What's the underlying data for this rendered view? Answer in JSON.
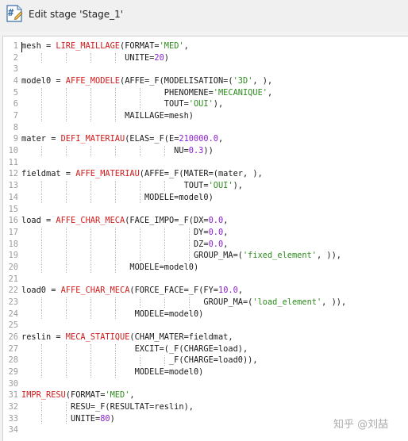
{
  "window": {
    "title": "Edit stage 'Stage_1'",
    "icon": "hash-document-icon"
  },
  "watermark": "知乎 @刘喆",
  "colors": {
    "command": "#d11a1a",
    "string": "#2e8b1e",
    "number": "#8a1fd1",
    "line_number": "#9a9a9a"
  },
  "lines": [
    {
      "n": "1",
      "t": [
        [
          "mesh = ",
          ""
        ],
        [
          "LIRE_MAILLAGE",
          "kw"
        ],
        [
          "(FORMAT=",
          ""
        ],
        [
          "'MED'",
          "str"
        ],
        [
          ",",
          ""
        ]
      ]
    },
    {
      "n": "2",
      "t": [
        [
          "                     UNITE=",
          ""
        ],
        [
          "20",
          "num"
        ],
        [
          ")",
          ""
        ]
      ]
    },
    {
      "n": "3",
      "t": []
    },
    {
      "n": "4",
      "t": [
        [
          "model0 = ",
          ""
        ],
        [
          "AFFE_MODELE",
          "kw"
        ],
        [
          "(AFFE=_F(MODELISATION=(",
          ""
        ],
        [
          "'3D'",
          "str"
        ],
        [
          ", ),",
          ""
        ]
      ]
    },
    {
      "n": "5",
      "t": [
        [
          "                             PHENOMENE=",
          ""
        ],
        [
          "'MECANIQUE'",
          "str"
        ],
        [
          ",",
          ""
        ]
      ]
    },
    {
      "n": "6",
      "t": [
        [
          "                             TOUT=",
          ""
        ],
        [
          "'OUI'",
          "str"
        ],
        [
          "),",
          ""
        ]
      ]
    },
    {
      "n": "7",
      "t": [
        [
          "                     MAILLAGE=mesh)",
          ""
        ]
      ]
    },
    {
      "n": "8",
      "t": []
    },
    {
      "n": "9",
      "t": [
        [
          "mater = ",
          ""
        ],
        [
          "DEFI_MATERIAU",
          "kw"
        ],
        [
          "(ELAS=_F(E=",
          ""
        ],
        [
          "210000.0",
          "num"
        ],
        [
          ",",
          ""
        ]
      ]
    },
    {
      "n": "10",
      "t": [
        [
          "                               NU=",
          ""
        ],
        [
          "0.3",
          "num"
        ],
        [
          "))",
          ""
        ]
      ]
    },
    {
      "n": "11",
      "t": []
    },
    {
      "n": "12",
      "t": [
        [
          "fieldmat = ",
          ""
        ],
        [
          "AFFE_MATERIAU",
          "kw"
        ],
        [
          "(AFFE=_F(MATER=(mater, ),",
          ""
        ]
      ]
    },
    {
      "n": "13",
      "t": [
        [
          "                                 TOUT=",
          ""
        ],
        [
          "'OUI'",
          "str"
        ],
        [
          "),",
          ""
        ]
      ]
    },
    {
      "n": "14",
      "t": [
        [
          "                         MODELE=model0)",
          ""
        ]
      ]
    },
    {
      "n": "15",
      "t": []
    },
    {
      "n": "16",
      "t": [
        [
          "load = ",
          ""
        ],
        [
          "AFFE_CHAR_MECA",
          "kw"
        ],
        [
          "(FACE_IMPO=_F(DX=",
          ""
        ],
        [
          "0.0",
          "num"
        ],
        [
          ",",
          ""
        ]
      ]
    },
    {
      "n": "17",
      "t": [
        [
          "                                   DY=",
          ""
        ],
        [
          "0.0",
          "num"
        ],
        [
          ",",
          ""
        ]
      ]
    },
    {
      "n": "18",
      "t": [
        [
          "                                   DZ=",
          ""
        ],
        [
          "0.0",
          "num"
        ],
        [
          ",",
          ""
        ]
      ]
    },
    {
      "n": "19",
      "t": [
        [
          "                                   GROUP_MA=(",
          ""
        ],
        [
          "'fixed_element'",
          "str"
        ],
        [
          ", )),",
          ""
        ]
      ]
    },
    {
      "n": "20",
      "t": [
        [
          "                      MODELE=model0)",
          ""
        ]
      ]
    },
    {
      "n": "21",
      "t": []
    },
    {
      "n": "22",
      "t": [
        [
          "load0 = ",
          ""
        ],
        [
          "AFFE_CHAR_MECA",
          "kw"
        ],
        [
          "(FORCE_FACE=_F(FY=",
          ""
        ],
        [
          "10.0",
          "num"
        ],
        [
          ",",
          ""
        ]
      ]
    },
    {
      "n": "23",
      "t": [
        [
          "                                     GROUP_MA=(",
          ""
        ],
        [
          "'load_element'",
          "str"
        ],
        [
          ", )),",
          ""
        ]
      ]
    },
    {
      "n": "24",
      "t": [
        [
          "                       MODELE=model0)",
          ""
        ]
      ]
    },
    {
      "n": "25",
      "t": []
    },
    {
      "n": "26",
      "t": [
        [
          "reslin = ",
          ""
        ],
        [
          "MECA_STATIQUE",
          "kw"
        ],
        [
          "(CHAM_MATER=fieldmat,",
          ""
        ]
      ]
    },
    {
      "n": "27",
      "t": [
        [
          "                       EXCIT=(_F(CHARGE=load),",
          ""
        ]
      ]
    },
    {
      "n": "28",
      "t": [
        [
          "                              _F(CHARGE=load0)),",
          ""
        ]
      ]
    },
    {
      "n": "29",
      "t": [
        [
          "                       MODELE=model0)",
          ""
        ]
      ]
    },
    {
      "n": "30",
      "t": []
    },
    {
      "n": "31",
      "t": [
        [
          "IMPR_RESU",
          "kw"
        ],
        [
          "(FORMAT=",
          ""
        ],
        [
          "'MED'",
          "str"
        ],
        [
          ",",
          ""
        ]
      ]
    },
    {
      "n": "32",
      "t": [
        [
          "          RESU=_F(RESULTAT=reslin),",
          ""
        ]
      ]
    },
    {
      "n": "33",
      "t": [
        [
          "          UNITE=",
          ""
        ],
        [
          "80",
          "num"
        ],
        [
          ")",
          ""
        ]
      ]
    },
    {
      "n": "34",
      "t": []
    }
  ]
}
